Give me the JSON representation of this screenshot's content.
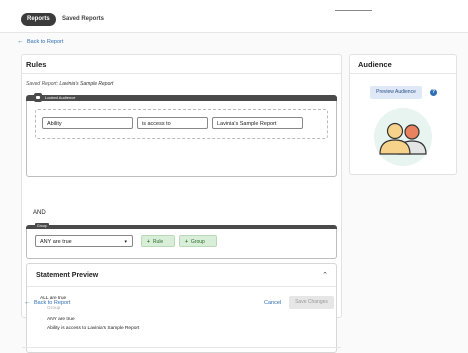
{
  "tabs": [
    {
      "label": "Reports",
      "active": true
    },
    {
      "label": "Saved Reports",
      "active": false
    }
  ],
  "nav": {
    "back_top": "Back to Report",
    "back_bottom": "Back to Report"
  },
  "rules": {
    "title": "Rules",
    "saved_label": "Saved Report:",
    "saved_value": "Lavinia's Sample Report",
    "locked_label": "Locked Audience",
    "condition": {
      "field": "Ability",
      "operator": "is access to",
      "value": "Lavinia's Sample Report"
    },
    "and_label": "AND",
    "group": {
      "tag": "Group",
      "select_value": "ANY are true",
      "rule_button": "Rule",
      "group_button": "Group"
    }
  },
  "statement_preview": {
    "title": "Statement Preview",
    "lines": [
      "ALL are true",
      "Group",
      "ANY are true",
      "Ability is access to Lavinia's Sample Report"
    ]
  },
  "footer": {
    "cancel": "Cancel",
    "save": "Save Changes"
  },
  "audience": {
    "title": "Audience",
    "preview_button": "Preview Audience",
    "help": "?"
  },
  "colors": {
    "accent": "#2f6fb3",
    "locked_header": "#4a4a4a",
    "green_button": "#d9eed9",
    "preview_button": "#dfe8f7"
  }
}
